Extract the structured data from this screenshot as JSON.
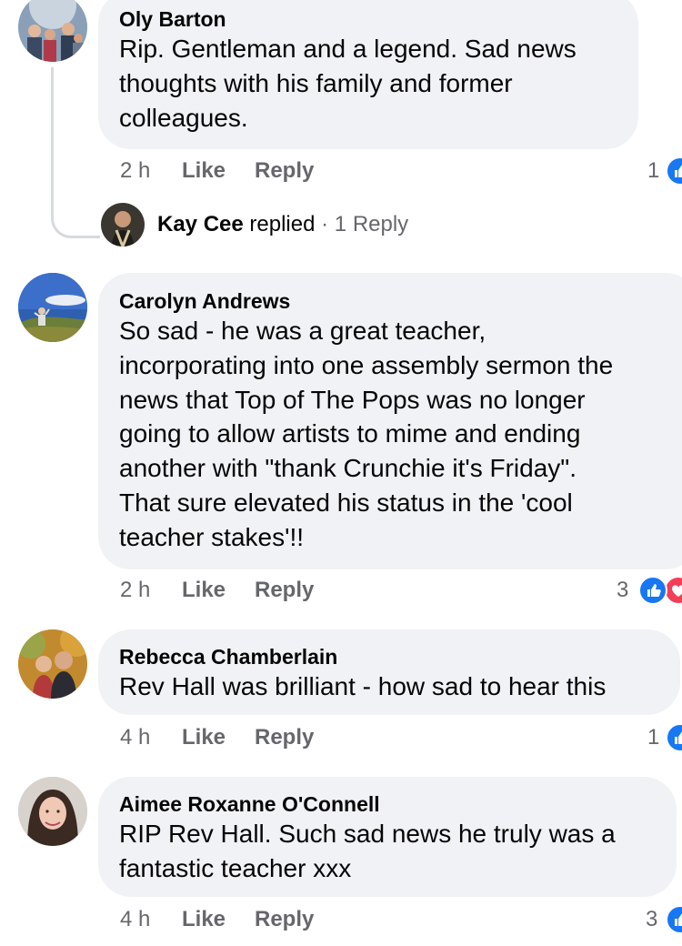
{
  "comments": [
    {
      "name": "Oly Barton",
      "text": "Rip. Gentleman and a legend. Sad news\nthoughts with his family and former\ncolleagues.",
      "time": "2 h",
      "like": "Like",
      "reply": "Reply",
      "reaction_count": "1",
      "reactions": [
        "like-icon"
      ]
    },
    {
      "name": "Carolyn Andrews",
      "text": "So sad - he was a great teacher,\nincorporating into one assembly sermon the\nnews that Top of The Pops was no longer\ngoing to allow artists to mime and ending\nanother with \"thank Crunchie it's Friday\".\nThat sure elevated his status in the 'cool\nteacher stakes'!!",
      "time": "2 h",
      "like": "Like",
      "reply": "Reply",
      "reaction_count": "3",
      "reactions": [
        "like-icon",
        "love-icon"
      ]
    },
    {
      "name": "Rebecca Chamberlain",
      "text": "Rev Hall was brilliant - how sad to hear this",
      "time": "4 h",
      "like": "Like",
      "reply": "Reply",
      "reaction_count": "1",
      "reactions": [
        "like-icon"
      ]
    },
    {
      "name": "Aimee Roxanne O'Connell",
      "text": "RIP Rev Hall. Such sad news he truly was a\nfantastic teacher xxx",
      "time": "4 h",
      "like": "Like",
      "reply": "Reply",
      "reaction_count": "3",
      "reactions": [
        "like-icon"
      ]
    }
  ],
  "reply_thread": {
    "name": "Kay Cee",
    "replied": "replied",
    "separator": "·",
    "count": "1 Reply"
  },
  "colors": {
    "bubble": "#f0f2f5",
    "meta_text": "#65676b",
    "like_blue": "#1877f2",
    "love_red": "#f33e58"
  }
}
